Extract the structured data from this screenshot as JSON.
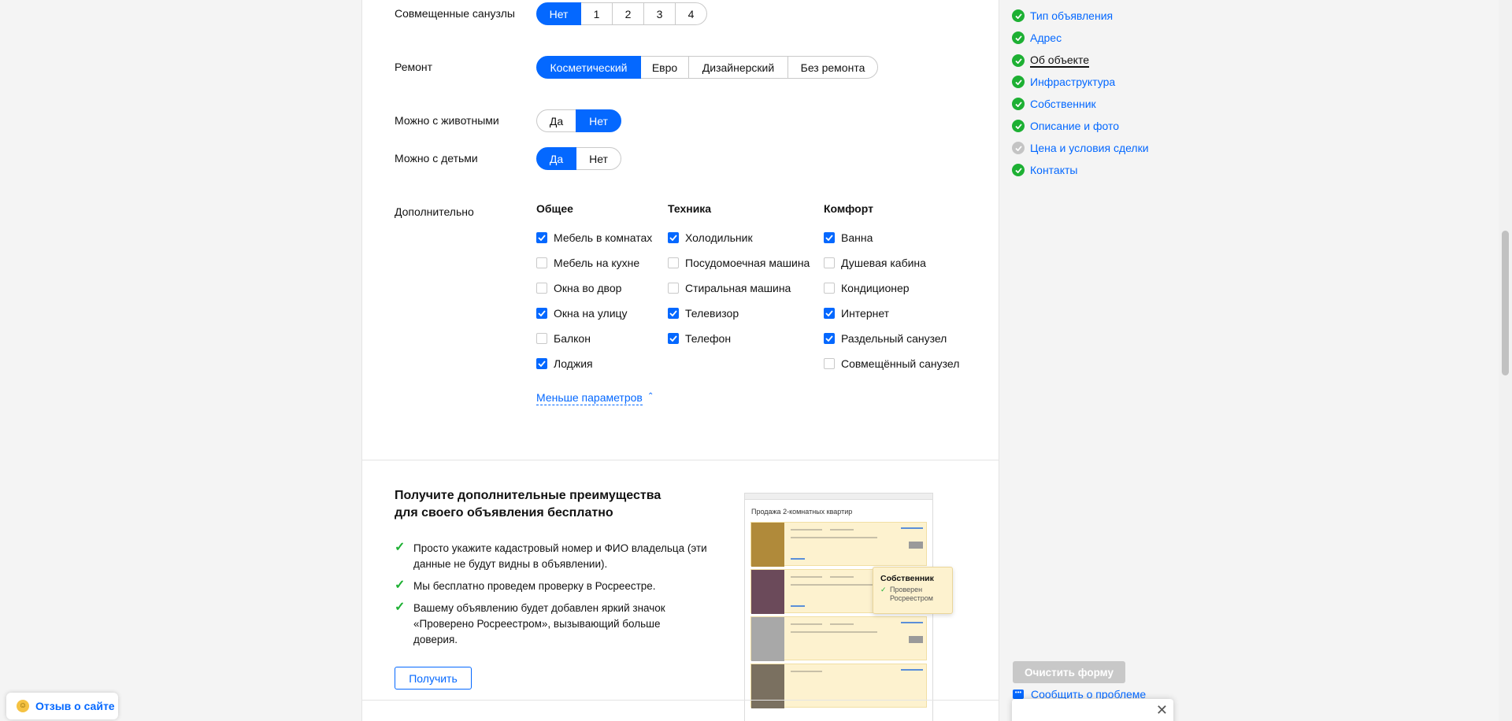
{
  "form": {
    "combined_bathrooms": {
      "label": "Совмещенные санузлы",
      "options": [
        "Нет",
        "1",
        "2",
        "3",
        "4"
      ],
      "selected": "Нет"
    },
    "repair": {
      "label": "Ремонт",
      "options": [
        "Косметический",
        "Евро",
        "Дизайнерский",
        "Без ремонта"
      ],
      "selected": "Косметический"
    },
    "pets": {
      "label": "Можно с животными",
      "options": [
        "Да",
        "Нет"
      ],
      "selected": "Нет"
    },
    "children": {
      "label": "Можно с детьми",
      "options": [
        "Да",
        "Нет"
      ],
      "selected": "Да"
    },
    "extra": {
      "label": "Дополнительно",
      "general": {
        "title": "Общее",
        "items": [
          {
            "label": "Мебель в комнатах",
            "checked": true
          },
          {
            "label": "Мебель на кухне",
            "checked": false
          },
          {
            "label": "Окна во двор",
            "checked": false
          },
          {
            "label": "Окна на улицу",
            "checked": true
          },
          {
            "label": "Балкон",
            "checked": false
          },
          {
            "label": "Лоджия",
            "checked": true
          }
        ]
      },
      "appliances": {
        "title": "Техника",
        "items": [
          {
            "label": "Холодильник",
            "checked": true
          },
          {
            "label": "Посудомоечная машина",
            "checked": false
          },
          {
            "label": "Стиральная машина",
            "checked": false
          },
          {
            "label": "Телевизор",
            "checked": true
          },
          {
            "label": "Телефон",
            "checked": true
          }
        ]
      },
      "comfort": {
        "title": "Комфорт",
        "items": [
          {
            "label": "Ванна",
            "checked": true
          },
          {
            "label": "Душевая кабина",
            "checked": false
          },
          {
            "label": "Кондиционер",
            "checked": false
          },
          {
            "label": "Интернет",
            "checked": true
          },
          {
            "label": "Раздельный санузел",
            "checked": true
          },
          {
            "label": "Совмещённый санузел",
            "checked": false
          }
        ]
      },
      "less_params": "Меньше параметров"
    }
  },
  "promo": {
    "title_line1": "Получите дополнительные преимущества",
    "title_line2": "для своего объявления бесплатно",
    "items": [
      "Просто укажите кадастровый номер и ФИО владельца (эти данные не будут видны в объявлении).",
      "Мы бесплатно проведем проверку в Росреестре.",
      "Вашему объявлению будет добавлен яркий значок «Проверено Росреестром», вызывающий больше доверия."
    ],
    "button": "Получить",
    "mockup": {
      "title": "Продажа 2-комнатных квартир",
      "popup_title": "Собственник",
      "popup_text": "Проверен Росреестром"
    }
  },
  "nav": {
    "items": [
      {
        "label": "Тип объявления",
        "status": "done"
      },
      {
        "label": "Адрес",
        "status": "done"
      },
      {
        "label": "Об объекте",
        "status": "current"
      },
      {
        "label": "Инфраструктура",
        "status": "done"
      },
      {
        "label": "Собственник",
        "status": "done"
      },
      {
        "label": "Описание и фото",
        "status": "done"
      },
      {
        "label": "Цена и условия сделки",
        "status": "pending"
      },
      {
        "label": "Контакты",
        "status": "done"
      }
    ],
    "clear_button": "Очистить форму",
    "report_link": "Сообщить о проблеме"
  },
  "feedback": {
    "label": "Отзыв о сайте"
  },
  "colors": {
    "accent": "#0468ff",
    "success": "#1db033",
    "muted": "#c4c4c4"
  }
}
